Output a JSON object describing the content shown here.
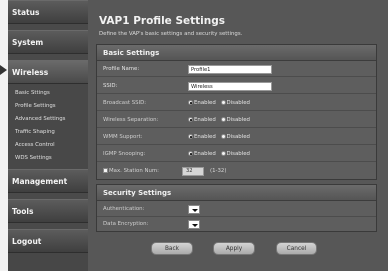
{
  "sidebar": {
    "status": "Status",
    "system": "System",
    "wireless": "Wireless",
    "wireless_items": [
      "Basic Sttings",
      "Profile Settings",
      "Advanced Settings",
      "Traffic Shaping",
      "Access Control",
      "WDS Settings"
    ],
    "management": "Management",
    "tools": "Tools",
    "logout": "Logout"
  },
  "page": {
    "title": "VAP1 Profile Settings",
    "description": "Define the VAP's basic settings and security settings."
  },
  "basic": {
    "header": "Basic Settings",
    "profile_name_label": "Profile Name:",
    "profile_name_value": "Profile1",
    "ssid_label": "SSID:",
    "ssid_value": "Wireless",
    "broadcast_ssid_label": "Broadcast SSID:",
    "wireless_separation_label": "Wireless Separation:",
    "wmm_support_label": "WMM Support:",
    "igmp_snooping_label": "IGMP Snooping:",
    "enabled": "Enabled",
    "disabled": "Disabled",
    "max_station_label": "Max. Station Num:",
    "max_station_value": "32",
    "max_station_range": "(1-32)"
  },
  "security": {
    "header": "Security Settings",
    "authentication_label": "Authentication:",
    "data_encryption_label": "Data Encryption:"
  },
  "buttons": {
    "back": "Back",
    "apply": "Apply",
    "cancel": "Cancel"
  },
  "colors": {
    "background": "#575757",
    "sidebar": "#474747"
  },
  "radio_states": {
    "broadcast_ssid": "Enabled",
    "wireless_separation": "Enabled",
    "wmm_support": "Enabled",
    "igmp_snooping": "Enabled"
  }
}
